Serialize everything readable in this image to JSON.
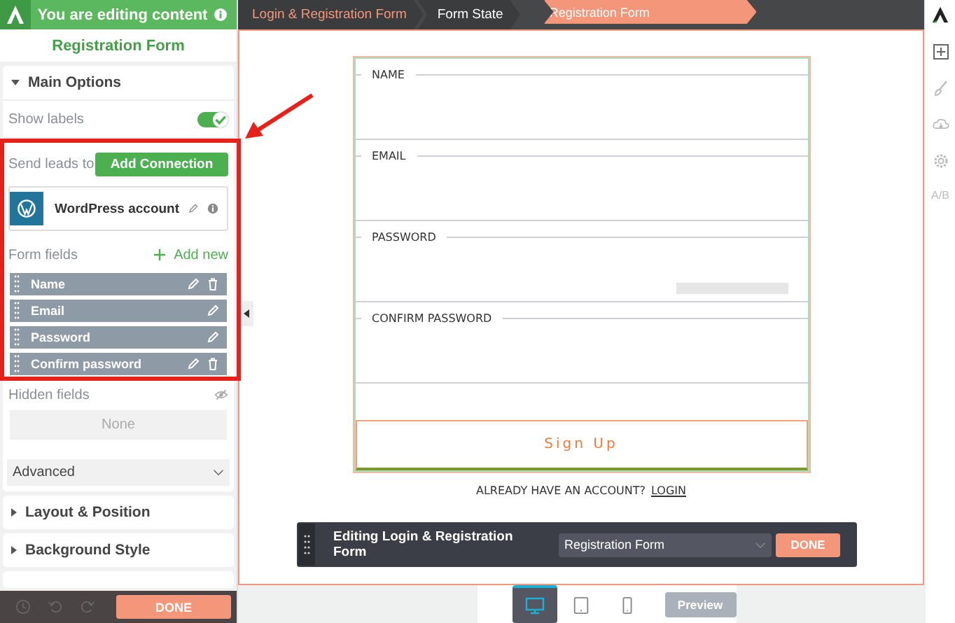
{
  "header": {
    "title": "You are editing content"
  },
  "panel_title": "Registration Form",
  "main_options": {
    "title": "Main Options",
    "expanded": true
  },
  "show_labels": {
    "label": "Show labels",
    "on": true
  },
  "send_leads": {
    "label": "Send leads to",
    "button": "Add Connection"
  },
  "connection": {
    "name": "WordPress account"
  },
  "form_fields": {
    "label": "Form fields",
    "add": "Add new",
    "items": [
      {
        "name": "Name",
        "deletable": true
      },
      {
        "name": "Email",
        "deletable": false
      },
      {
        "name": "Password",
        "deletable": false
      },
      {
        "name": "Confirm password",
        "deletable": true
      }
    ]
  },
  "hidden_fields": {
    "label": "Hidden fields",
    "value": "None"
  },
  "advanced": {
    "label": "Advanced"
  },
  "sections": [
    {
      "title": "Layout & Position",
      "expanded": false
    },
    {
      "title": "Background Style",
      "expanded": false
    }
  ],
  "footer": {
    "done": "DONE"
  },
  "breadcrumbs": [
    {
      "label": "Login & Registration Form",
      "selected": false,
      "kind": "root"
    },
    {
      "label": "Form State",
      "selected": false,
      "kind": "state"
    },
    {
      "label": "Registration Form",
      "selected": true,
      "kind": "state"
    }
  ],
  "form": {
    "fields": [
      {
        "label": "NAME",
        "kind": "text"
      },
      {
        "label": "EMAIL",
        "kind": "text"
      },
      {
        "label": "PASSWORD",
        "kind": "password"
      },
      {
        "label": "CONFIRM PASSWORD",
        "kind": "text"
      }
    ],
    "submit": "Sign Up",
    "login_prompt": "ALREADY HAVE AN ACCOUNT?",
    "login_link": "LOGIN"
  },
  "toolbar": {
    "title": "Editing Login & Registration Form",
    "state": "Registration Form",
    "done": "DONE"
  },
  "devices": [
    {
      "kind": "desktop",
      "selected": true
    },
    {
      "kind": "tablet",
      "selected": false
    },
    {
      "kind": "phone",
      "selected": false
    }
  ],
  "preview": "Preview",
  "ab_label": "A/B"
}
